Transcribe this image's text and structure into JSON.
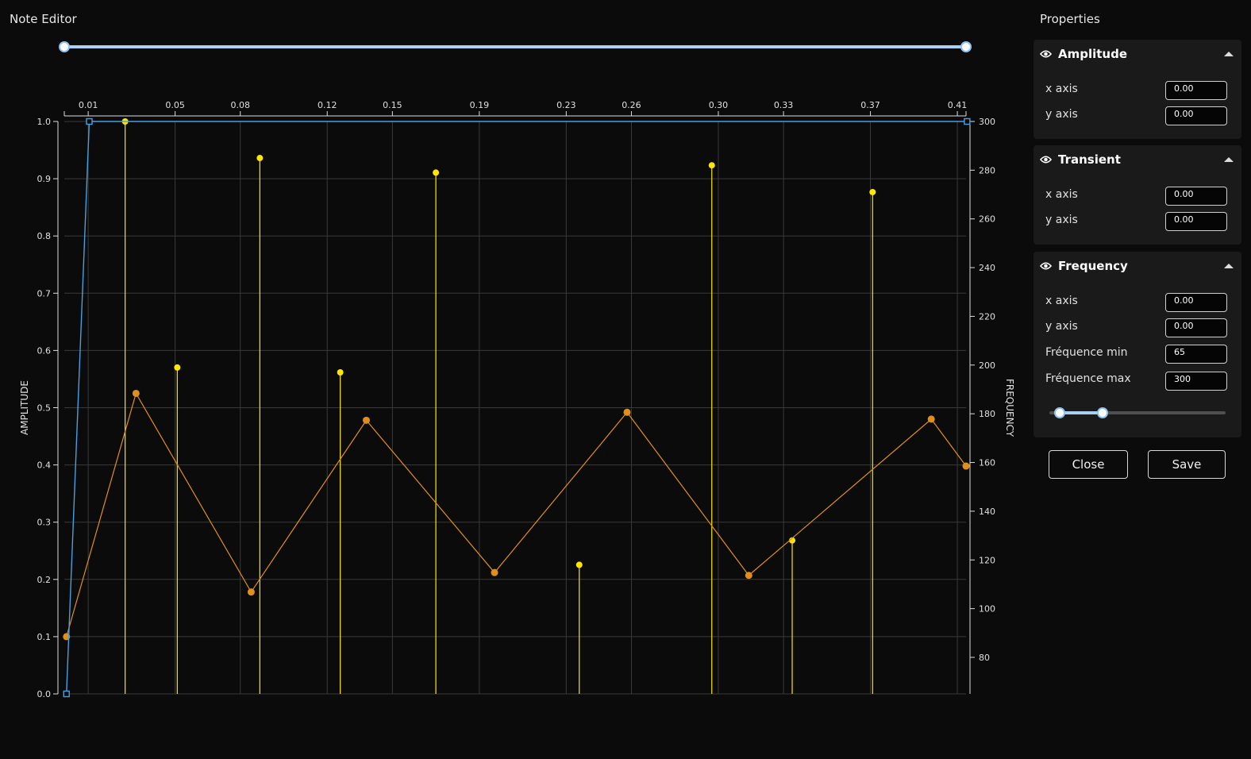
{
  "header": {
    "title": "Note Editor",
    "properties_title": "Properties"
  },
  "time_range": {
    "start": 0,
    "end": 1
  },
  "chart_data": {
    "type": "line",
    "x_ticks": [
      "0.01",
      "0.05",
      "0.08",
      "0.12",
      "0.15",
      "0.19",
      "0.23",
      "0.26",
      "0.30",
      "0.33",
      "0.37",
      "0.41"
    ],
    "x_domain": [
      -0.001,
      0.414
    ],
    "left_axis": {
      "label": "AMPLITUDE",
      "ylim": [
        0,
        1.0
      ],
      "ticks": [
        "0.0",
        "0.1",
        "0.2",
        "0.3",
        "0.4",
        "0.5",
        "0.6",
        "0.7",
        "0.8",
        "0.9",
        "1.0"
      ]
    },
    "right_axis": {
      "label": "FREQUENCY",
      "ylim": [
        65,
        300
      ],
      "ticks": [
        "80",
        "100",
        "120",
        "140",
        "160",
        "180",
        "200",
        "220",
        "240",
        "260",
        "280",
        "300"
      ]
    },
    "series": [
      {
        "color": "#4a9fe0",
        "axis": "left",
        "marker": "square",
        "x": [
          0.0,
          0.0105,
          0.4145
        ],
        "y": [
          0.0,
          1.0,
          1.0
        ]
      },
      {
        "color": "#e0901a",
        "axis": "left",
        "marker": "circle",
        "x": [
          0.0,
          0.032,
          0.085,
          0.138,
          0.197,
          0.258,
          0.314,
          0.398,
          0.414
        ],
        "y": [
          0.1,
          0.525,
          0.178,
          0.478,
          0.212,
          0.492,
          0.207,
          0.48,
          0.398
        ]
      },
      {
        "color": "#ffe600",
        "axis": "right",
        "style": "stem",
        "x": [
          0.027,
          0.051,
          0.089,
          0.126,
          0.17,
          0.236,
          0.297,
          0.334,
          0.371
        ],
        "y": [
          300,
          199,
          285,
          197,
          279,
          118,
          282,
          128,
          271
        ]
      }
    ]
  },
  "panels": [
    {
      "title": "Amplitude",
      "icon": "eye-icon",
      "fields": [
        {
          "label": "x axis",
          "value": "0.00"
        },
        {
          "label": "y axis",
          "value": "0.00"
        }
      ]
    },
    {
      "title": "Transient",
      "icon": "eye-icon",
      "fields": [
        {
          "label": "x axis",
          "value": "0.00"
        },
        {
          "label": "y axis",
          "value": "0.00"
        }
      ]
    },
    {
      "title": "Frequency",
      "icon": "eye-icon",
      "fields": [
        {
          "label": "x axis",
          "value": "0.00"
        },
        {
          "label": "y axis",
          "value": "0.00"
        },
        {
          "label": "Fréquence min",
          "value": "65"
        },
        {
          "label": "Fréquence max",
          "value": "300"
        }
      ],
      "range": {
        "low": 0.06,
        "high": 0.3
      }
    }
  ],
  "buttons": {
    "close": "Close",
    "save": "Save"
  },
  "colors": {
    "accent": "#a9cff5",
    "amplitude": "#4a9fe0",
    "transient": "#e0901a",
    "frequency": "#ffe600"
  }
}
